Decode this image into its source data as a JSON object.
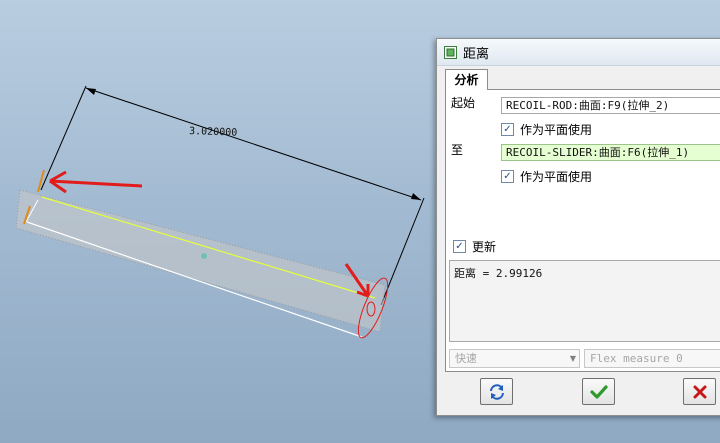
{
  "model": {
    "dimension_value": "3.020000"
  },
  "dialog": {
    "title": "距离",
    "tab": "分析",
    "from_label": "起始",
    "from_ref": "RECOIL-ROD:曲面:F9(拉伸_2)",
    "from_plane_label": "作为平面使用",
    "from_plane_checked": true,
    "to_label": "至",
    "to_ref": "RECOIL-SLIDER:曲面:F6(拉伸_1)",
    "to_plane_label": "作为平面使用",
    "to_plane_checked": true,
    "update_label": "更新",
    "update_checked": true,
    "result": "距离 = 2.99126",
    "mode_select": "快速",
    "flex_select": "Flex measure 0",
    "buttons": {
      "repaint": "refresh-icon",
      "ok": "checkmark-icon",
      "cancel": "cross-icon"
    }
  },
  "colors": {
    "accent_green": "#2e9a2e",
    "cancel_red": "#c51919",
    "annotation_red": "#e21b1b"
  }
}
